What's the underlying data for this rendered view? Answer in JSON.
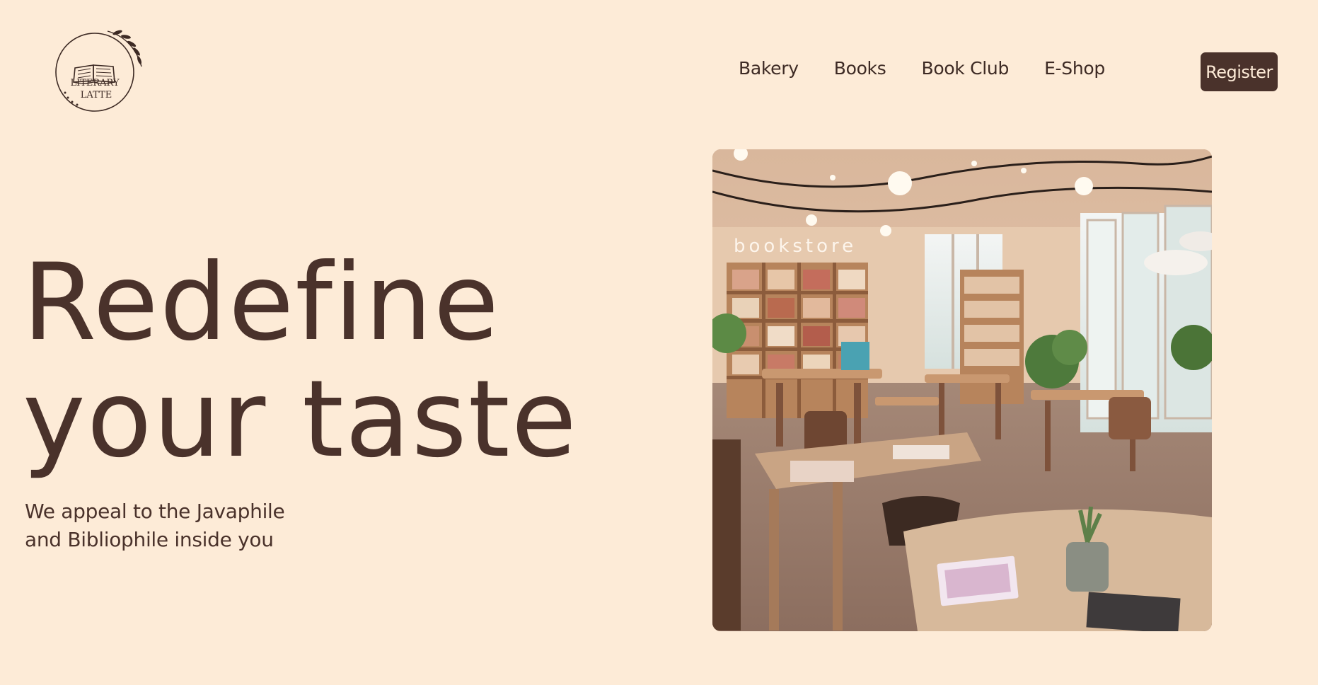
{
  "brand": {
    "logo_line1": "LITERARY",
    "logo_line2": "LATTE"
  },
  "nav": {
    "items": [
      {
        "label": "Bakery"
      },
      {
        "label": "Books"
      },
      {
        "label": "Book Club"
      },
      {
        "label": "E-Shop"
      }
    ],
    "register_label": "Register"
  },
  "hero": {
    "title_line1": "Redefine",
    "title_line2": "your taste",
    "subtitle_line1": "We appeal to the Javaphile",
    "subtitle_line2": "and Bibliophile inside you",
    "image_sign": "bookstore"
  },
  "colors": {
    "background": "#fdebd7",
    "text": "#4a322b",
    "button_bg": "#4a322b",
    "button_text": "#fdebd7"
  }
}
